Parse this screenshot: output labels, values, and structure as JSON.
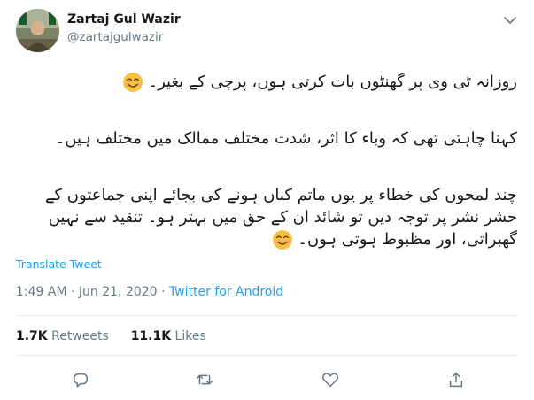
{
  "user": {
    "display_name": "Zartaj Gul Wazir",
    "handle": "@zartajgulwazir"
  },
  "tweet": {
    "lines": [
      "روزانہ ٹی وی پر گھنٹوں بات کرتی ہوں، پرچی کے بغیر۔",
      "کہنا چاہتی تھی کہ وباء کا اثر، شدت مختلف ممالک میں مختلف ہیں۔",
      "چند لمحوں کی خطاء پر یوں ماتم کناں ہونے کی بجائے اپنی جماعتوں کے",
      "حشر نشر پر توجہ دیں تو شائد ان کے حق میں بہتر ہو۔ تنقید سے نہیں",
      "گھبراتی، اور مظبوط ہوتی ہوں۔"
    ],
    "emoji": "smiling-face-with-smiling-eyes"
  },
  "translate_label": "Translate Tweet",
  "meta": {
    "time": "1:49 AM",
    "date": "Jun 21, 2020",
    "separator": "·",
    "source": "Twitter for Android"
  },
  "stats": {
    "retweets_count": "1.7K",
    "retweets_label": "Retweets",
    "likes_count": "11.1K",
    "likes_label": "Likes"
  },
  "icons": {
    "caret": "chevron-down-icon",
    "reply": "reply-icon",
    "retweet": "retweet-icon",
    "like": "heart-icon",
    "share": "share-icon"
  },
  "colors": {
    "link": "#1da1f2",
    "secondary_text": "#657786",
    "divider": "#e6ecf0",
    "emoji_face": "#f7c33c",
    "emoji_blush": "#f39a9a"
  }
}
